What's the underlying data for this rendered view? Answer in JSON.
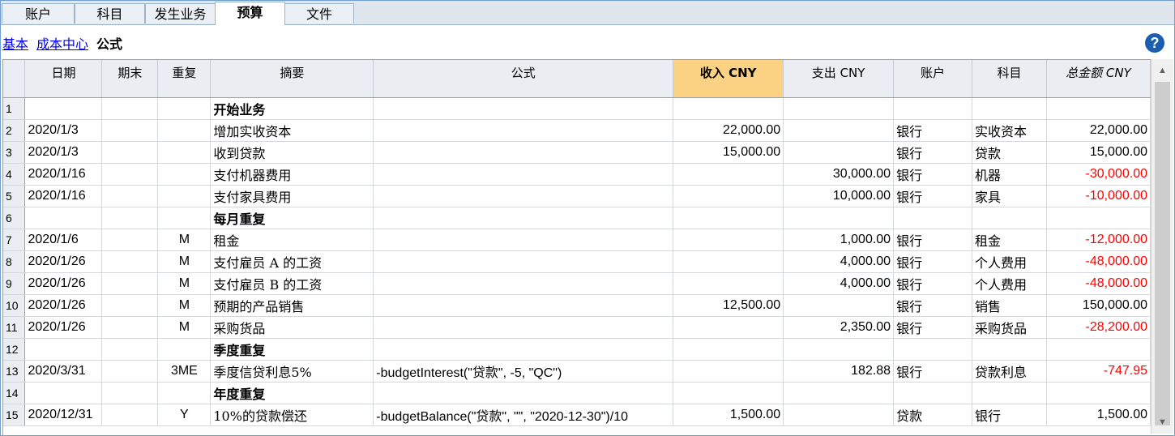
{
  "tabs": [
    "账户",
    "科目",
    "发生业务",
    "预算",
    "文件"
  ],
  "active_tab": "预算",
  "subnav": {
    "links": [
      "基本",
      "成本中心"
    ],
    "current": "公式"
  },
  "help_icon": "?",
  "columns": [
    "",
    "日期",
    "期末",
    "重复",
    "摘要",
    "公式",
    "收入 CNY",
    "支出 CNY",
    "账户",
    "科目",
    "总金额 CNY"
  ],
  "rows": [
    {
      "n": "1",
      "date": "",
      "end": "",
      "rep": "",
      "desc": "开始业务",
      "formula": "",
      "income": "",
      "expense": "",
      "account": "",
      "category": "",
      "total": "",
      "header": true,
      "neg": false
    },
    {
      "n": "2",
      "date": "2020/1/3",
      "end": "",
      "rep": "",
      "desc": "增加实收资本",
      "formula": "",
      "income": "22,000.00",
      "expense": "",
      "account": "银行",
      "category": "实收资本",
      "total": "22,000.00",
      "header": false,
      "neg": false
    },
    {
      "n": "3",
      "date": "2020/1/3",
      "end": "",
      "rep": "",
      "desc": "收到贷款",
      "formula": "",
      "income": "15,000.00",
      "expense": "",
      "account": "银行",
      "category": "贷款",
      "total": "15,000.00",
      "header": false,
      "neg": false
    },
    {
      "n": "4",
      "date": "2020/1/16",
      "end": "",
      "rep": "",
      "desc": "支付机器费用",
      "formula": "",
      "income": "",
      "expense": "30,000.00",
      "account": "银行",
      "category": "机器",
      "total": "-30,000.00",
      "header": false,
      "neg": true
    },
    {
      "n": "5",
      "date": "2020/1/16",
      "end": "",
      "rep": "",
      "desc": "支付家具费用",
      "formula": "",
      "income": "",
      "expense": "10,000.00",
      "account": "银行",
      "category": "家具",
      "total": "-10,000.00",
      "header": false,
      "neg": true
    },
    {
      "n": "6",
      "date": "",
      "end": "",
      "rep": "",
      "desc": "每月重复",
      "formula": "",
      "income": "",
      "expense": "",
      "account": "",
      "category": "",
      "total": "",
      "header": true,
      "neg": false
    },
    {
      "n": "7",
      "date": "2020/1/6",
      "end": "",
      "rep": "M",
      "desc": " 租金",
      "formula": "",
      "income": "",
      "expense": "1,000.00",
      "account": "银行",
      "category": "租金",
      "total": "-12,000.00",
      "header": false,
      "neg": true
    },
    {
      "n": "8",
      "date": "2020/1/26",
      "end": "",
      "rep": "M",
      "desc": "支付雇员 A 的工资",
      "formula": "",
      "income": "",
      "expense": "4,000.00",
      "account": "银行",
      "category": "个人费用",
      "total": "-48,000.00",
      "header": false,
      "neg": true
    },
    {
      "n": "9",
      "date": "2020/1/26",
      "end": "",
      "rep": "M",
      "desc": "支付雇员 B 的工资",
      "formula": "",
      "income": "",
      "expense": "4,000.00",
      "account": "银行",
      "category": "个人费用",
      "total": "-48,000.00",
      "header": false,
      "neg": true
    },
    {
      "n": "10",
      "date": "2020/1/26",
      "end": "",
      "rep": "M",
      "desc": "预期的产品销售",
      "formula": "",
      "income": "12,500.00",
      "expense": "",
      "account": "银行",
      "category": "销售",
      "total": "150,000.00",
      "header": false,
      "neg": false
    },
    {
      "n": "11",
      "date": "2020/1/26",
      "end": "",
      "rep": "M",
      "desc": "采购货品",
      "formula": "",
      "income": "",
      "expense": "2,350.00",
      "account": "银行",
      "category": "采购货品",
      "total": "-28,200.00",
      "header": false,
      "neg": true
    },
    {
      "n": "12",
      "date": "",
      "end": "",
      "rep": "",
      "desc": "季度重复",
      "formula": "",
      "income": "",
      "expense": "",
      "account": "",
      "category": "",
      "total": "",
      "header": true,
      "neg": false
    },
    {
      "n": "13",
      "date": "2020/3/31",
      "end": "",
      "rep": "3ME",
      "desc": "季度信贷利息5%",
      "formula": "-budgetInterest(\"贷款\", -5, \"QC\")",
      "income": "",
      "expense": "182.88",
      "account": "银行",
      "category": "贷款利息",
      "total": "-747.95",
      "header": false,
      "neg": true
    },
    {
      "n": "14",
      "date": "",
      "end": "",
      "rep": "",
      "desc": "年度重复",
      "formula": "",
      "income": "",
      "expense": "",
      "account": "",
      "category": "",
      "total": "",
      "header": true,
      "neg": false
    },
    {
      "n": "15",
      "date": "2020/12/31",
      "end": "",
      "rep": "Y",
      "desc": "10%的贷款偿还",
      "formula": "-budgetBalance(\"贷款\", \"\", \"2020-12-30\")/10",
      "income": "1,500.00",
      "expense": "",
      "account": "贷款",
      "category": "银行",
      "total": "1,500.00",
      "header": false,
      "neg": false
    }
  ],
  "scrollbar": {
    "up_icon": "▲",
    "down_icon": "▼"
  },
  "colors": {
    "highlight_header": "#fbd184",
    "negative": "#ff0000",
    "link": "#0000ee",
    "help": "#1c5fae"
  }
}
